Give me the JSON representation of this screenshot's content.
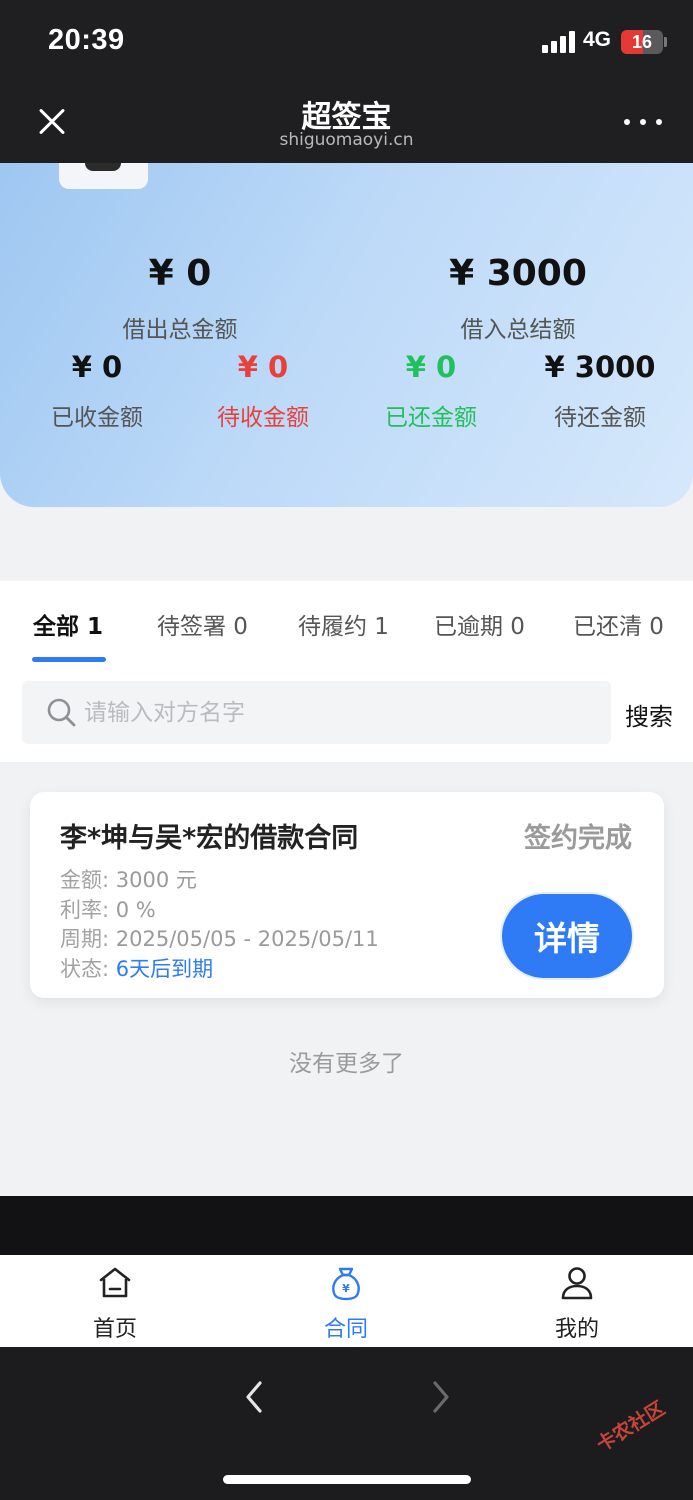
{
  "status_bar": {
    "time": "20:39",
    "network": "4G",
    "battery": "16"
  },
  "header": {
    "title": "超签宝",
    "subtitle": "shiguomaoyi.cn"
  },
  "summary": {
    "lent_total": "¥ 0",
    "lent_total_label": "借出总金额",
    "borrowed_total": "¥ 3000",
    "borrowed_total_label": "借入总结额",
    "received": "¥ 0",
    "received_label": "已收金额",
    "to_receive": "¥ 0",
    "to_receive_label": "待收金额",
    "repaid": "¥ 0",
    "repaid_label": "已还金额",
    "to_repay": "¥ 3000",
    "to_repay_label": "待还金额"
  },
  "colors": {
    "accent": "#2f7bf6",
    "red": "#e8413a",
    "green": "#22c05c"
  },
  "tabs": [
    {
      "label": "全部 1"
    },
    {
      "label": "待签署 0"
    },
    {
      "label": "待履约 1"
    },
    {
      "label": "已逾期 0"
    },
    {
      "label": "已还清 0"
    }
  ],
  "search": {
    "placeholder": "请输入对方名字",
    "button": "搜索"
  },
  "contract": {
    "title": "李*坤与吴*宏的借款合同",
    "status": "签约完成",
    "amount_label": "金额:",
    "amount": "3000 元",
    "rate_label": "利率:",
    "rate": "0 %",
    "period_label": "周期:",
    "period": "2025/05/05 - 2025/05/11",
    "state_label": "状态:",
    "state": "6天后到期",
    "detail_button": "详情"
  },
  "list_footer": "没有更多了",
  "tabbar": {
    "home": "首页",
    "contract": "合同",
    "mine": "我的"
  },
  "watermark": "卡农社区"
}
